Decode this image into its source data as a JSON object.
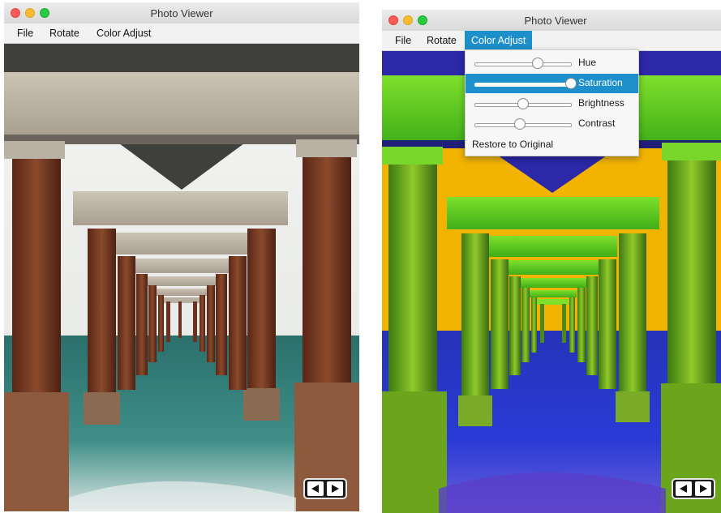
{
  "left_window": {
    "title": "Photo Viewer",
    "menus": [
      "File",
      "Rotate",
      "Color Adjust"
    ]
  },
  "right_window": {
    "title": "Photo Viewer",
    "menus": [
      "File",
      "Rotate",
      "Color Adjust"
    ],
    "active_menu": "Color Adjust",
    "color_adjust_menu": {
      "sliders": [
        {
          "label": "Hue",
          "value": 0.65
        },
        {
          "label": "Saturation",
          "value": 1.0,
          "highlighted": true
        },
        {
          "label": "Brightness",
          "value": 0.5
        },
        {
          "label": "Contrast",
          "value": 0.47
        }
      ],
      "restore_label": "Restore to Original"
    }
  },
  "nav_buttons": {
    "prev_icon": "left-arrow-icon",
    "next_icon": "right-arrow-icon"
  },
  "colors": {
    "menu_highlight": "#1d8fcb",
    "rust": "#7a3a26",
    "concrete": "#bdb4a6",
    "water": "#2e7f78",
    "inverted_green": "#6dd22a",
    "inverted_blue": "#2a2ad0",
    "inverted_sky": "#f2b400"
  }
}
